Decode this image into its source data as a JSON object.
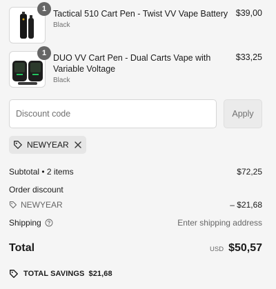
{
  "items": [
    {
      "title": "Tactical 510 Cart Pen - Twist VV Vape Battery",
      "variant": "Black",
      "price": "$39,00",
      "quantity": "1"
    },
    {
      "title": "DUO VV Cart Pen - Dual Carts Vape with Variable Voltage",
      "variant": "Black",
      "price": "$33,25",
      "quantity": "1"
    }
  ],
  "discount": {
    "placeholder": "Discount code",
    "apply_label": "Apply",
    "applied_code": "NEWYEAR"
  },
  "summary": {
    "subtotal_label": "Subtotal • 2 items",
    "subtotal_value": "$72,25",
    "order_discount_label": "Order discount",
    "discount_code": "NEWYEAR",
    "discount_value": "– $21,68",
    "shipping_label": "Shipping",
    "shipping_value": "Enter shipping address",
    "total_label": "Total",
    "currency": "USD",
    "total_value": "$50,57",
    "savings_label": "TOTAL SAVINGS",
    "savings_value": "$21,68"
  },
  "colors": {
    "accent": "#1a1a1a",
    "muted": "#707070",
    "badge": "#666666"
  }
}
